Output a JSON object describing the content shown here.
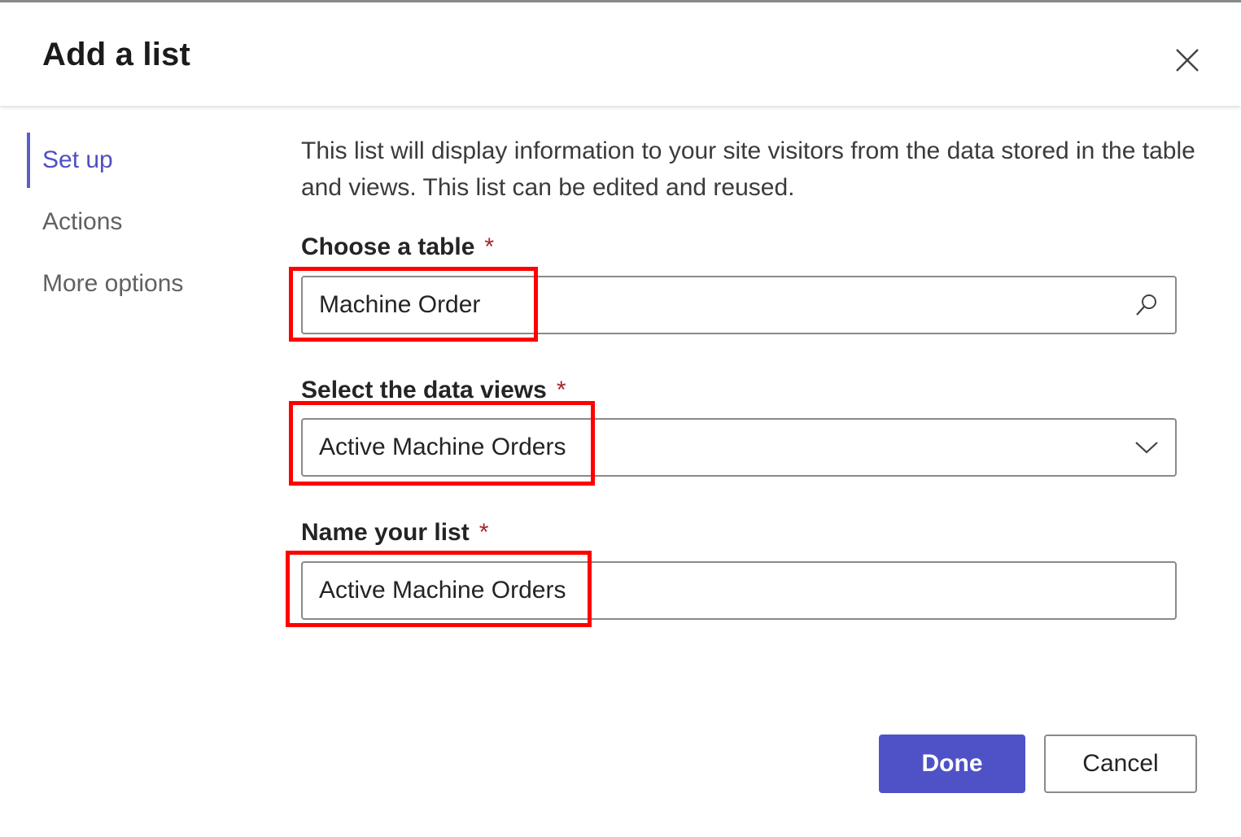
{
  "dialog": {
    "title": "Add a list"
  },
  "nav": {
    "items": [
      {
        "label": "Set up",
        "active": true
      },
      {
        "label": "Actions",
        "active": false
      },
      {
        "label": "More options",
        "active": false
      }
    ]
  },
  "content": {
    "description": "This list will display information to your site visitors from the data stored in the table and views. This list can be edited and reused.",
    "table_field": {
      "label": "Choose a table",
      "required_mark": "*",
      "value": "Machine Order",
      "icon": "search-icon"
    },
    "views_field": {
      "label": "Select the data views",
      "required_mark": "*",
      "value": "Active Machine Orders",
      "icon": "chevron-down-icon"
    },
    "name_field": {
      "label": "Name your list",
      "required_mark": "*",
      "value": "Active Machine Orders"
    }
  },
  "footer": {
    "done_label": "Done",
    "cancel_label": "Cancel"
  },
  "colors": {
    "accent": "#4f52c7",
    "highlight": "#ff0000",
    "required": "#a4262c"
  }
}
